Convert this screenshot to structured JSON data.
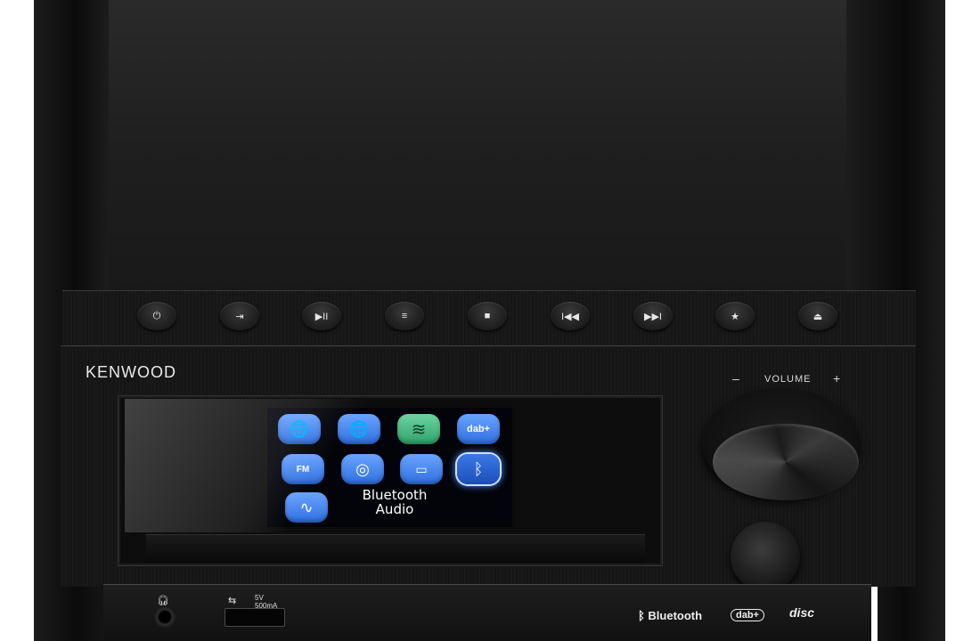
{
  "device": {
    "brand": "KENWOOD"
  },
  "buttons": [
    {
      "name": "power",
      "glyph": "⏻"
    },
    {
      "name": "input",
      "glyph": "⇥"
    },
    {
      "name": "play-pause",
      "glyph": "▶II"
    },
    {
      "name": "menu",
      "glyph": "≡"
    },
    {
      "name": "stop",
      "glyph": "■"
    },
    {
      "name": "previous",
      "glyph": "I◀◀"
    },
    {
      "name": "next",
      "glyph": "▶▶I"
    },
    {
      "name": "favorite",
      "glyph": "★"
    },
    {
      "name": "eject",
      "glyph": "⏏"
    }
  ],
  "screen": {
    "tiles": [
      {
        "id": "internet-radio-eq",
        "glyph": "🌐"
      },
      {
        "id": "podcast",
        "glyph": "🌐"
      },
      {
        "id": "spotify",
        "glyph": "≋"
      },
      {
        "id": "dab",
        "glyph": "dab+"
      },
      {
        "id": "fm",
        "glyph": "FM"
      },
      {
        "id": "cd",
        "glyph": "◎"
      },
      {
        "id": "usb",
        "glyph": "▭"
      },
      {
        "id": "bluetooth",
        "glyph": "ᛒ",
        "selected": true
      },
      {
        "id": "aux",
        "glyph": "∿"
      }
    ],
    "selected_label_line1": "Bluetooth",
    "selected_label_line2": "Audio"
  },
  "volume": {
    "label": "VOLUME",
    "minus": "–",
    "plus": "+"
  },
  "ports": {
    "usb_rating_line1": "5V",
    "usb_rating_line2": "500mA"
  },
  "badges": {
    "bluetooth": "Bluetooth",
    "dab": "dab+",
    "disc": "disc"
  },
  "colors": {
    "tile_blue": "#2f6fe0",
    "spotify_green": "#2fa36b",
    "body": "#151515"
  }
}
